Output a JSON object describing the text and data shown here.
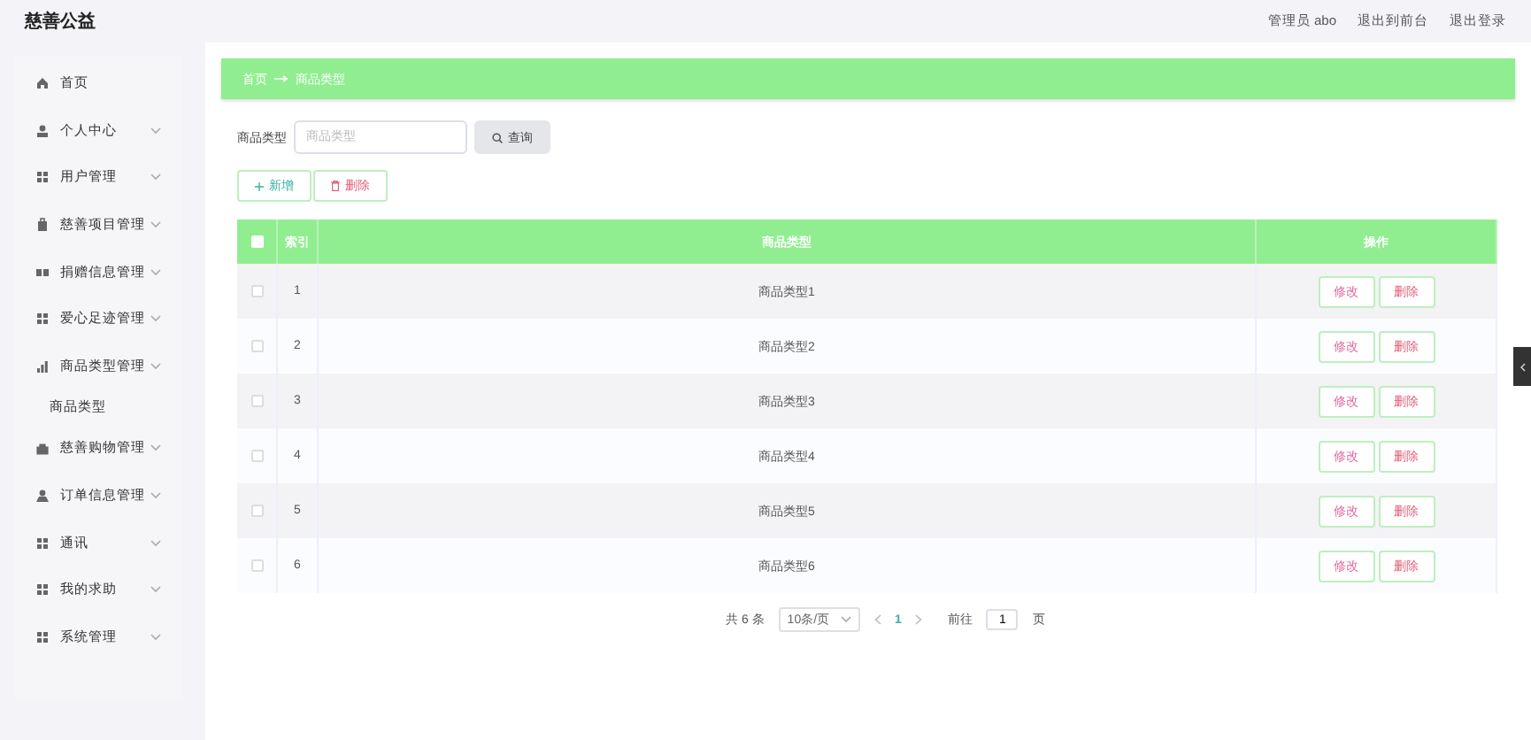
{
  "header": {
    "title": "慈善公益",
    "user": "管理员 abo",
    "links": [
      "退出到前台",
      "退出登录"
    ]
  },
  "sidebar": {
    "items": [
      {
        "label": "首页",
        "expandable": false
      },
      {
        "label": "个人中心",
        "expandable": true
      },
      {
        "label": "用户管理",
        "expandable": true
      },
      {
        "label": "慈善项目管理",
        "expandable": true
      },
      {
        "label": "捐赠信息管理",
        "expandable": true
      },
      {
        "label": "爱心足迹管理",
        "expandable": true
      },
      {
        "label": "商品类型管理",
        "expandable": true,
        "children": [
          {
            "label": "商品类型"
          }
        ]
      },
      {
        "label": "慈善购物管理",
        "expandable": true
      },
      {
        "label": "订单信息管理",
        "expandable": true
      },
      {
        "label": "通讯",
        "expandable": true
      },
      {
        "label": "我的求助",
        "expandable": true
      },
      {
        "label": "系统管理",
        "expandable": true
      }
    ]
  },
  "breadcrumb": [
    "首页",
    "商品类型"
  ],
  "search": {
    "label": "商品类型",
    "placeholder": "商品类型",
    "button": "查询"
  },
  "toolbar": [
    {
      "label": "新增",
      "kind": "add"
    },
    {
      "label": "删除",
      "kind": "delete"
    }
  ],
  "table": {
    "select_all": false,
    "columns": [
      "索引",
      "商品类型",
      "操作"
    ],
    "rows": [
      {
        "index": "1",
        "name": "商品类型1",
        "selected": false,
        "actions": [
          "修改",
          "删除"
        ]
      },
      {
        "index": "2",
        "name": "商品类型2",
        "selected": false,
        "actions": [
          "修改",
          "删除"
        ]
      },
      {
        "index": "3",
        "name": "商品类型3",
        "selected": false,
        "actions": [
          "修改",
          "删除"
        ]
      },
      {
        "index": "4",
        "name": "商品类型4",
        "selected": false,
        "actions": [
          "修改",
          "删除"
        ]
      },
      {
        "index": "5",
        "name": "商品类型5",
        "selected": false,
        "actions": [
          "修改",
          "删除"
        ]
      },
      {
        "index": "6",
        "name": "商品类型6",
        "selected": false,
        "actions": [
          "修改",
          "删除"
        ]
      }
    ]
  },
  "pagination": {
    "total": "共 6 条",
    "page_size": "10条/页",
    "pages": [
      {
        "label": "1",
        "selected": true
      }
    ],
    "goto": "前往",
    "goto_value": "1",
    "goto_suffix": "页"
  }
}
